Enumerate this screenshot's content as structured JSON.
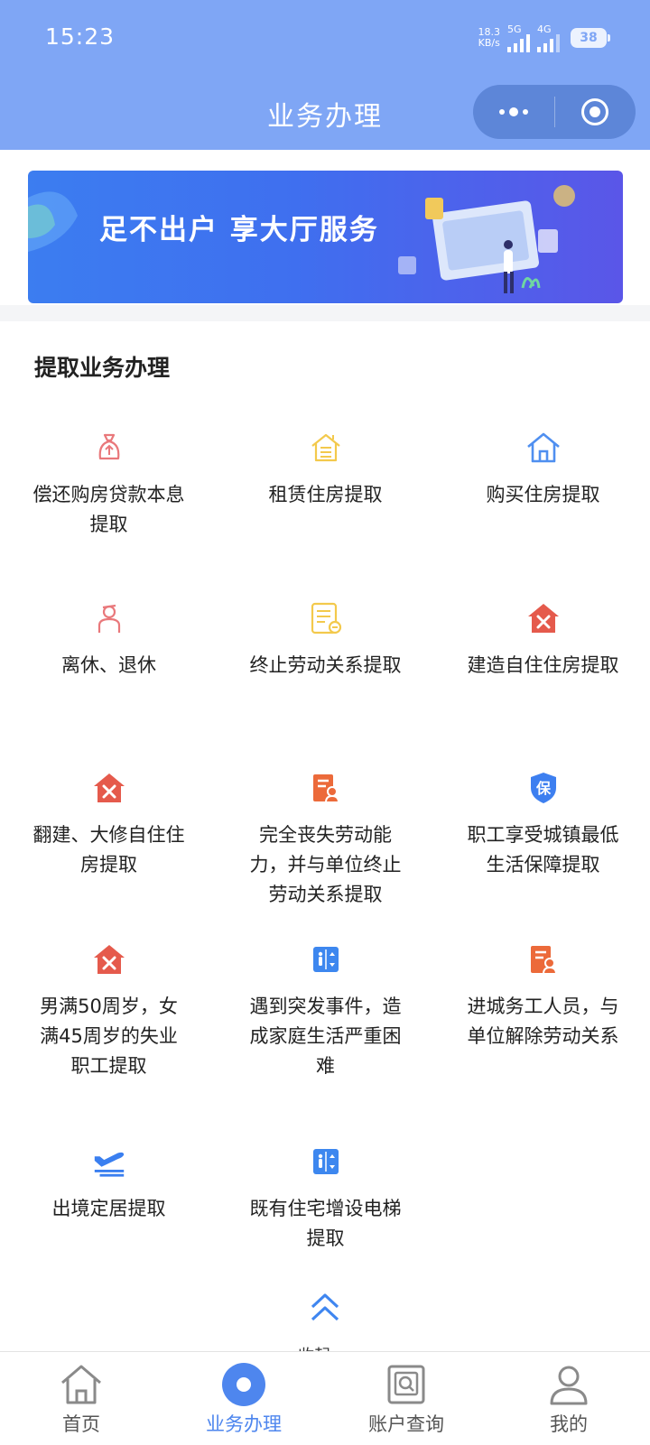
{
  "status_bar": {
    "time": "15:23",
    "net_speed_value": "18.3",
    "net_speed_unit": "KB/s",
    "sim1": "5G",
    "sim2": "4G",
    "battery": "38"
  },
  "header": {
    "title": "业务办理"
  },
  "banner": {
    "text": "足不出户 享大厅服务"
  },
  "section": {
    "title": "提取业务办理",
    "items": [
      {
        "label": "偿还购房贷款本息提取",
        "icon": "money-bag-icon",
        "color": "#e9787b"
      },
      {
        "label": "租赁住房提取",
        "icon": "rental-house-icon",
        "color": "#f3c94c"
      },
      {
        "label": "购买住房提取",
        "icon": "house-icon",
        "color": "#4f8ff0"
      },
      {
        "label": "离休、退休",
        "icon": "retiree-icon",
        "color": "#e9787b"
      },
      {
        "label": "终止劳动关系提取",
        "icon": "document-icon",
        "color": "#f3c94c"
      },
      {
        "label": "建造自住住房提取",
        "icon": "house-tools-icon",
        "color": "#e55a4c"
      },
      {
        "label": "翻建、大修自住住房提取",
        "icon": "house-tools-icon",
        "color": "#e55a4c"
      },
      {
        "label": "完全丧失劳动能力，并与单位终止劳动关系提取",
        "icon": "certificate-person-icon",
        "color": "#ec6a3a"
      },
      {
        "label": "职工享受城镇最低生活保障提取",
        "icon": "shield-icon",
        "color": "#3d7ff0"
      },
      {
        "label": "男满50周岁，女满45周岁的失业职工提取",
        "icon": "house-tools-icon",
        "color": "#e55a4c"
      },
      {
        "label": "遇到突发事件，造成家庭生活严重困难",
        "icon": "elevator-icon",
        "color": "#3d87ef"
      },
      {
        "label": "进城务工人员，与单位解除劳动关系",
        "icon": "certificate-person-icon",
        "color": "#ec6a3a"
      },
      {
        "label": "出境定居提取",
        "icon": "airplane-departure-icon",
        "color": "#3a7ff0"
      },
      {
        "label": "既有住宅增设电梯提取",
        "icon": "elevator-icon",
        "color": "#3d87ef"
      }
    ]
  },
  "collapse": {
    "label": "收起",
    "icon": "double-chevron-up-icon"
  },
  "tabbar": {
    "tabs": [
      {
        "label": "首页",
        "icon": "home-icon"
      },
      {
        "label": "业务办理",
        "icon": "business-icon"
      },
      {
        "label": "账户查询",
        "icon": "account-search-icon"
      },
      {
        "label": "我的",
        "icon": "user-icon"
      }
    ],
    "active_index": 1
  },
  "colors": {
    "header": "#7fa6f5",
    "accent": "#4e86ee"
  }
}
